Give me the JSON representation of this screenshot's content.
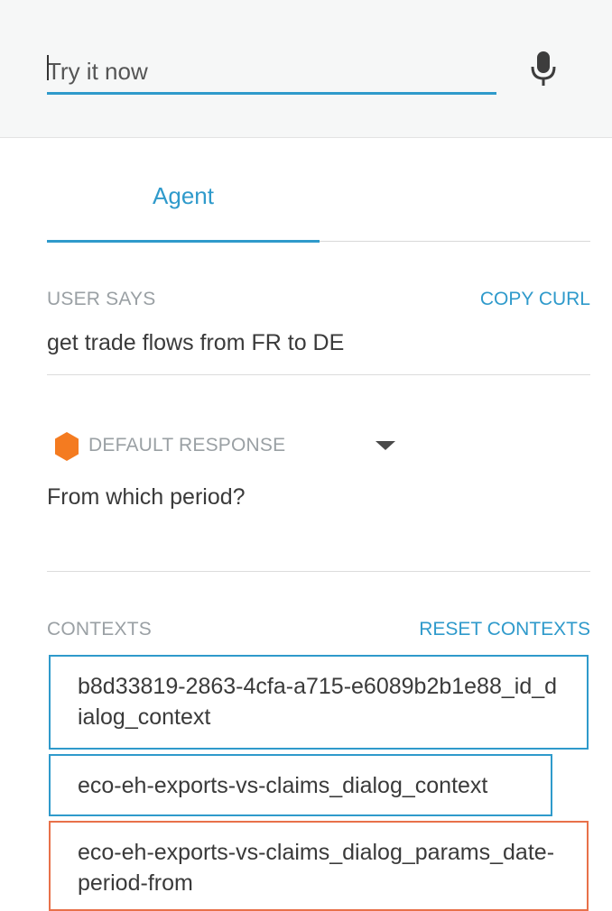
{
  "query": {
    "placeholder": "Try it now",
    "mic_icon": "microphone-icon"
  },
  "tabs": [
    {
      "label": "Agent",
      "active": true
    }
  ],
  "user_says": {
    "label": "USER SAYS",
    "action": "COPY CURL",
    "text": "get trade flows from FR to DE"
  },
  "response": {
    "icon": "hexagon-icon",
    "label": "DEFAULT RESPONSE",
    "text": "From which period?"
  },
  "contexts": {
    "label": "CONTEXTS",
    "action": "RESET CONTEXTS",
    "items": [
      {
        "name": "b8d33819-2863-4cfa-a715-e6089b2b1e88_id_dialog_context",
        "color": "#2f9acb"
      },
      {
        "name": "eco-eh-exports-vs-claims_dialog_context",
        "color": "#2f9acb"
      },
      {
        "name": "eco-eh-exports-vs-claims_dialog_params_date-period-from",
        "color": "#e8714a"
      }
    ]
  },
  "colors": {
    "accent": "#2f9acb",
    "warning": "#e8714a",
    "response_icon": "#f47b20"
  }
}
